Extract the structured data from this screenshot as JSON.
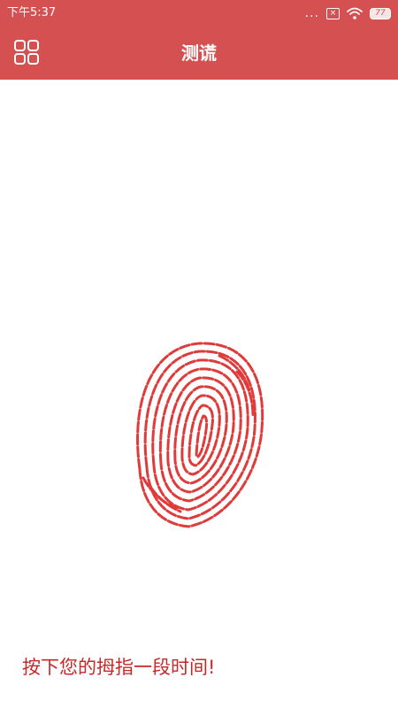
{
  "status_bar": {
    "time": "下午5:37",
    "signal_dots": "...",
    "battery_level": "77"
  },
  "app_bar": {
    "title": "测谎",
    "menu_icon": "grid-menu-icon"
  },
  "main": {
    "fingerprint_icon": "fingerprint-icon",
    "fingerprint_color": "#e03b3b",
    "prompt": "按下您的拇指一段时间!"
  },
  "colors": {
    "primary": "#d55050",
    "prompt_text": "#c62828",
    "background": "#ffffff"
  }
}
